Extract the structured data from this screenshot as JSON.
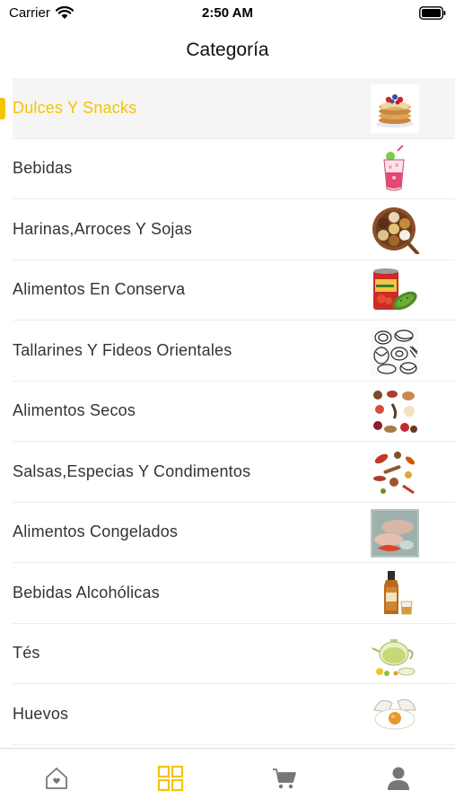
{
  "status_bar": {
    "carrier": "Carrier",
    "time": "2:50 AM"
  },
  "header": {
    "title": "Categoría"
  },
  "accent_color": "#f5c400",
  "categories": [
    {
      "label": "Dulces Y Snacks",
      "thumb": "pancakes"
    },
    {
      "label": "Bebidas",
      "thumb": "drink-glass"
    },
    {
      "label": "Harinas,Arroces Y Sojas",
      "thumb": "grain-tray"
    },
    {
      "label": "Alimentos En Conserva",
      "thumb": "canned-food"
    },
    {
      "label": "Tallarines Y Fideos Orientales",
      "thumb": "noodles"
    },
    {
      "label": "Alimentos Secos",
      "thumb": "dried-foods"
    },
    {
      "label": "Salsas,Especias Y Condimentos",
      "thumb": "spices"
    },
    {
      "label": "Alimentos Congelados",
      "thumb": "frozen-fish"
    },
    {
      "label": "Bebidas Alcohólicas",
      "thumb": "liquor-bottle"
    },
    {
      "label": "Tés",
      "thumb": "teapot"
    },
    {
      "label": "Huevos",
      "thumb": "eggs"
    }
  ],
  "selected_index": 0,
  "tabs": [
    {
      "icon": "home-icon"
    },
    {
      "icon": "grid-icon",
      "active": true
    },
    {
      "icon": "cart-icon"
    },
    {
      "icon": "user-icon"
    }
  ]
}
